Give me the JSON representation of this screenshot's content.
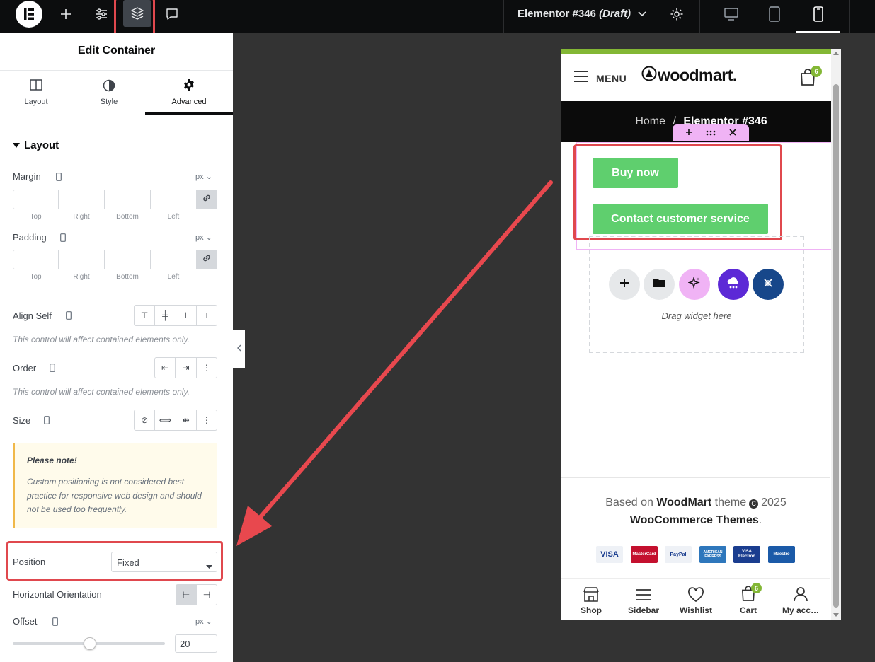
{
  "topbar": {
    "doc_title": "Elementor #346",
    "doc_status": "(Draft)"
  },
  "panel": {
    "title": "Edit Container",
    "tabs": [
      {
        "label": "Layout"
      },
      {
        "label": "Style"
      },
      {
        "label": "Advanced"
      }
    ],
    "section_title": "Layout",
    "margin": {
      "label": "Margin",
      "unit": "px",
      "sides": [
        "Top",
        "Right",
        "Bottom",
        "Left"
      ]
    },
    "padding": {
      "label": "Padding",
      "unit": "px",
      "sides": [
        "Top",
        "Right",
        "Bottom",
        "Left"
      ]
    },
    "align_self": {
      "label": "Align Self",
      "note": "This control will affect contained elements only."
    },
    "order": {
      "label": "Order",
      "note": "This control will affect contained elements only."
    },
    "size": {
      "label": "Size"
    },
    "notice": {
      "title": "Please note!",
      "text": "Custom positioning is not considered best practice for responsive web design and should not be used too frequently."
    },
    "position": {
      "label": "Position",
      "value": "Fixed"
    },
    "horizontal_orientation": {
      "label": "Horizontal Orientation"
    },
    "offset": {
      "label": "Offset",
      "unit": "px",
      "value": "20"
    }
  },
  "preview": {
    "menu_label": "MENU",
    "logo_text": "woodmart.",
    "cart_count": "6",
    "breadcrumb_home": "Home",
    "breadcrumb_sep": "/",
    "breadcrumb_current": "Elementor #346",
    "btn_buy": "Buy now",
    "btn_contact": "Contact customer service",
    "drag_text": "Drag widget here",
    "footer_line1_pre": "Based on ",
    "footer_line1_brand": "WoodMart",
    "footer_line1_post": " theme",
    "footer_year": "2025",
    "footer_line2": "WooCommerce Themes",
    "footer_line2_end": ".",
    "payments": [
      "VISA",
      "MasterCard",
      "PayPal",
      "AMERICAN EXPRESS",
      "VISA Electron",
      "Maestro"
    ],
    "bottom_nav": [
      {
        "label": "Shop"
      },
      {
        "label": "Sidebar"
      },
      {
        "label": "Wishlist"
      },
      {
        "label": "Cart",
        "badge": "6"
      },
      {
        "label": "My acc…"
      }
    ]
  },
  "colors": {
    "accent_green": "#5fcf6e",
    "highlight_red": "#e0484e",
    "elementor_pink": "#f0b3f5",
    "logo_green": "#83b735"
  }
}
